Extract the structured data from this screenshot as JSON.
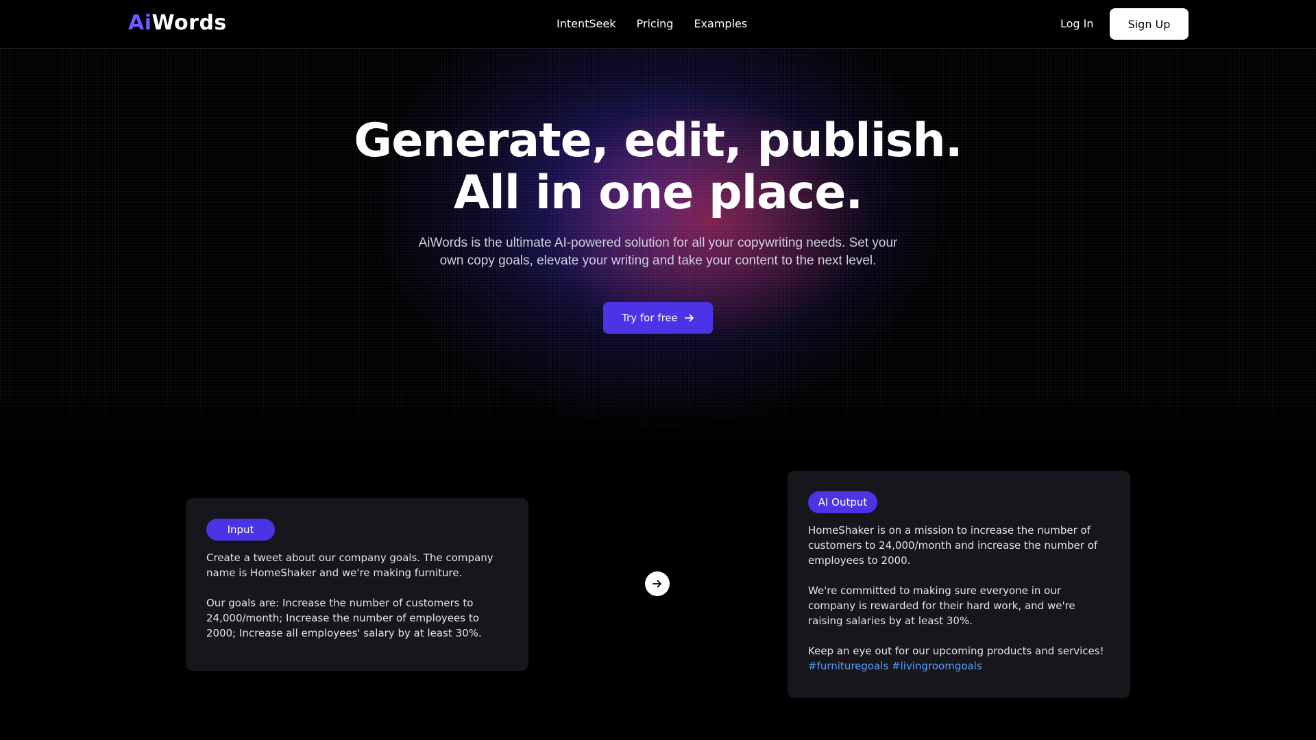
{
  "brand": {
    "logo_ai": "Ai",
    "logo_words": "Words"
  },
  "nav": {
    "links": [
      "IntentSeek",
      "Pricing",
      "Examples"
    ],
    "login_label": "Log In",
    "signup_label": "Sign Up"
  },
  "hero": {
    "headline_line1": "Generate, edit, publish.",
    "headline_line2": "All in one place.",
    "subtitle": "AiWords is the ultimate AI-powered solution for all your copywriting needs. Set your own copy goals, elevate your writing and take your content to the next level.",
    "cta_label": "Try for free",
    "cta_icon": "arrow-right-icon"
  },
  "demo": {
    "input": {
      "badge": "Input",
      "paragraphs": [
        "Create a tweet about our company goals. The company name is HomeShaker and we're making furniture.",
        "Our goals are: Increase the number of customers to 24,000/month; Increase the number of employees to 2000; Increase all employees' salary by at least 30%."
      ]
    },
    "arrow_icon": "arrow-right-icon",
    "output": {
      "badge": "AI Output",
      "paragraphs": [
        "HomeShaker is on a mission to increase the number of customers to 24,000/month and increase the number of employees to 2000.",
        "We're committed to making sure everyone in our company is rewarded for their hard work, and we're raising salaries by at least 30%.",
        "Keep an eye out for our upcoming products and services!"
      ],
      "hashtags": [
        "#furnituregoals",
        "#livingroomgoals"
      ]
    }
  },
  "colors": {
    "accent": "#4a34e6",
    "logo_accent": "#6a5cff",
    "hashtag": "#5b9cf5",
    "card_bg": "#16161c",
    "background": "#000000"
  }
}
